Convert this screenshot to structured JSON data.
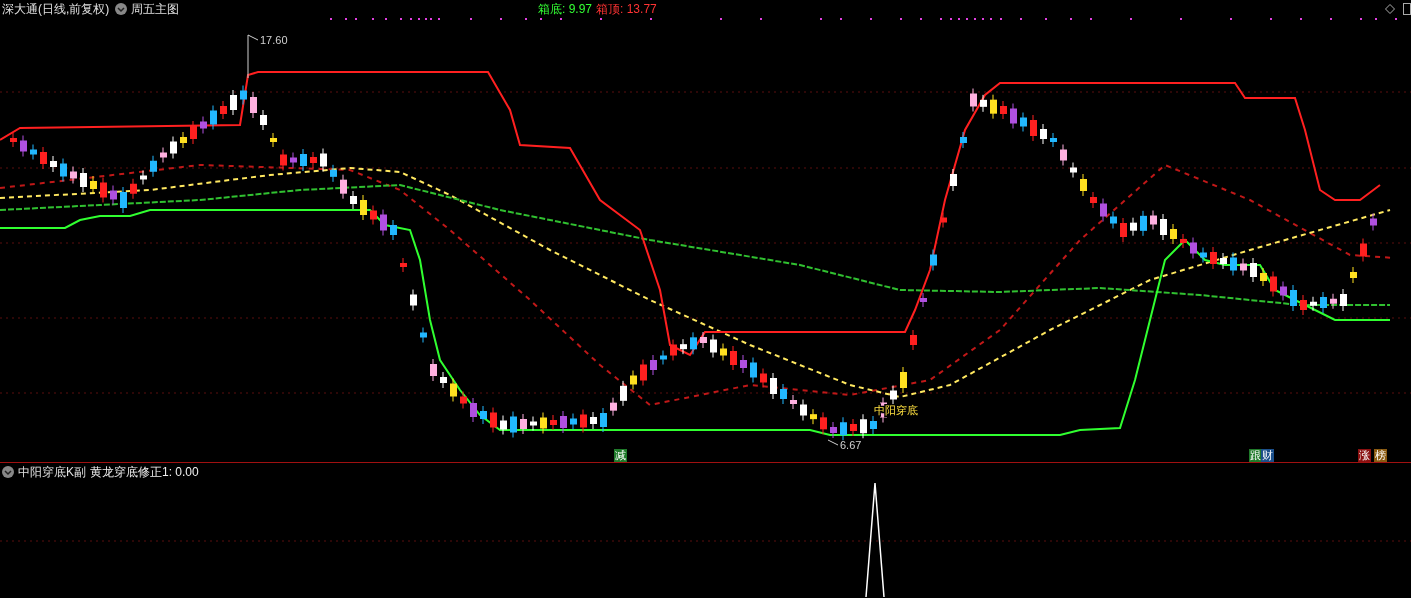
{
  "header": {
    "title": "深大通(日线,前复权)",
    "template": "周五主图",
    "readings": [
      {
        "text": "箱底: 9.97",
        "color": "#33ff33"
      },
      {
        "text": "箱顶: 13.77",
        "color": "#ff3333"
      }
    ]
  },
  "main_chart": {
    "labels": [
      {
        "kind": "high",
        "text": "17.60"
      },
      {
        "kind": "low",
        "text": "6.67"
      },
      {
        "kind": "signal",
        "text": "中阳穿底"
      }
    ],
    "tags": [
      {
        "text": "减",
        "color": "#1f7a2a"
      },
      {
        "text": "跟",
        "color": "#1f7a2a"
      },
      {
        "text": "财",
        "color": "#1b4f8a"
      },
      {
        "text": "涨",
        "color": "#8a1010"
      },
      {
        "text": "榜",
        "color": "#8a5a10"
      }
    ]
  },
  "sub_panel": {
    "title": "中阳穿底K副",
    "reading": "黄龙穿底修正1: 0.00"
  }
}
